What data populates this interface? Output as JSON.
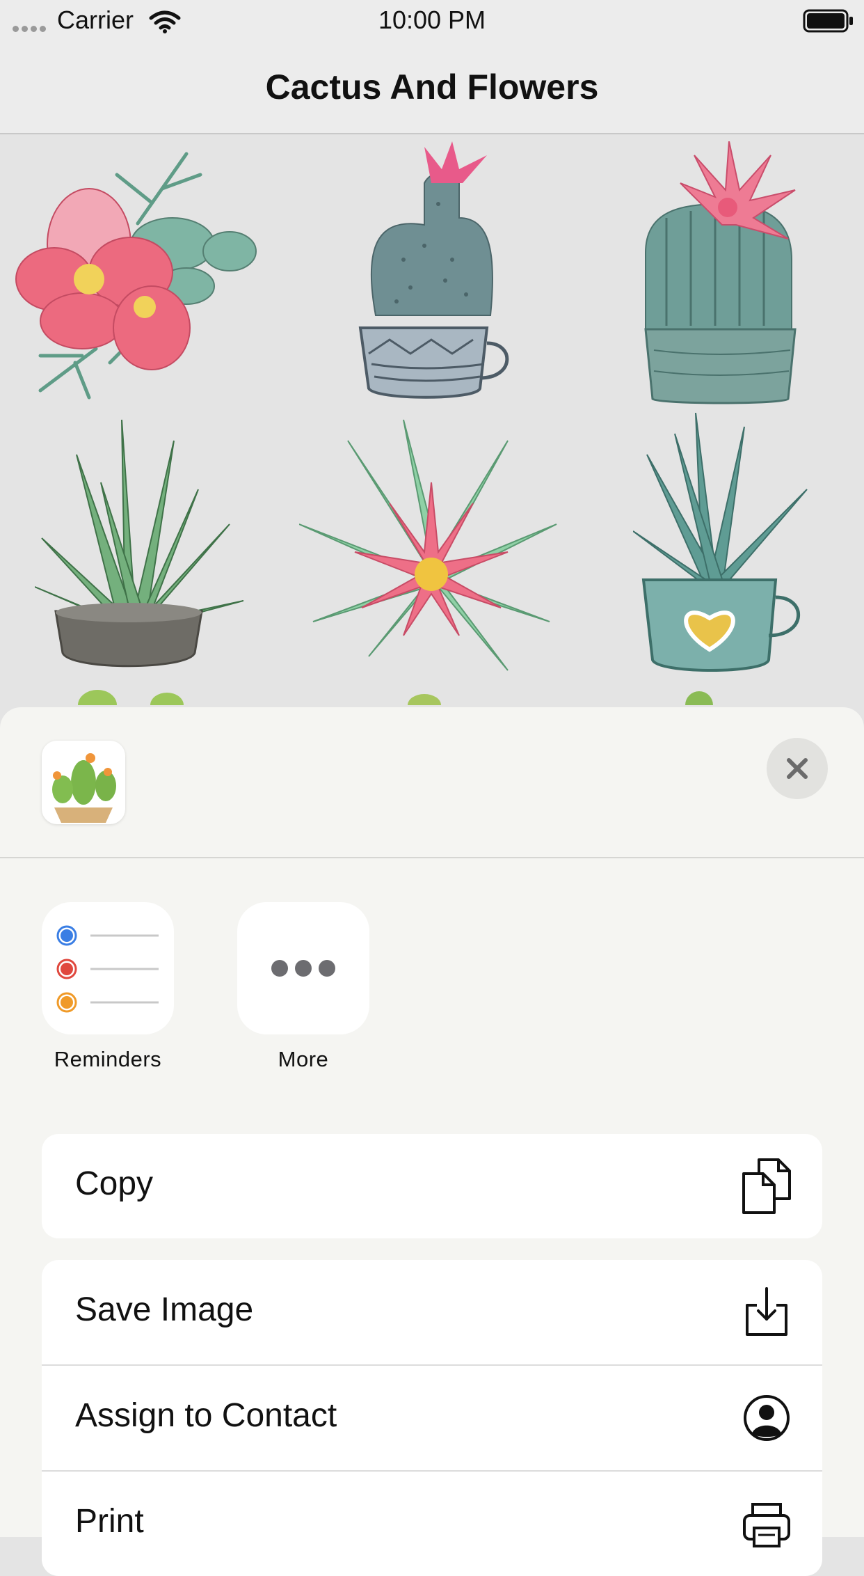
{
  "status_bar": {
    "carrier": "Carrier",
    "time": "10:00 PM",
    "icons": [
      "signal-dots-icon",
      "wifi-icon",
      "battery-icon"
    ]
  },
  "nav": {
    "title": "Cactus And Flowers"
  },
  "stickers": [
    {
      "name": "pink-flower-sticker"
    },
    {
      "name": "cactus-cup-sticker"
    },
    {
      "name": "flowering-barrel-cactus-sticker"
    },
    {
      "name": "succulent-bowl-sticker"
    },
    {
      "name": "pink-flower-succulent-sticker"
    },
    {
      "name": "succulent-heart-cup-sticker"
    }
  ],
  "share_sheet": {
    "close_icon": "close-icon",
    "apps": [
      {
        "label": "Reminders",
        "icon": "reminders-icon"
      },
      {
        "label": "More",
        "icon": "more-icon"
      }
    ],
    "actions_group_1": [
      {
        "label": "Copy",
        "icon": "copy-icon"
      }
    ],
    "actions_group_2": [
      {
        "label": "Save Image",
        "icon": "save-image-icon"
      },
      {
        "label": "Assign to Contact",
        "icon": "contact-icon"
      },
      {
        "label": "Print",
        "icon": "print-icon"
      }
    ]
  },
  "colors": {
    "background": "#e4e4e4",
    "sheet": "#f5f5f2",
    "reminder_blue": "#3a7ee4",
    "reminder_red": "#e0483e",
    "reminder_orange": "#f09a28"
  }
}
